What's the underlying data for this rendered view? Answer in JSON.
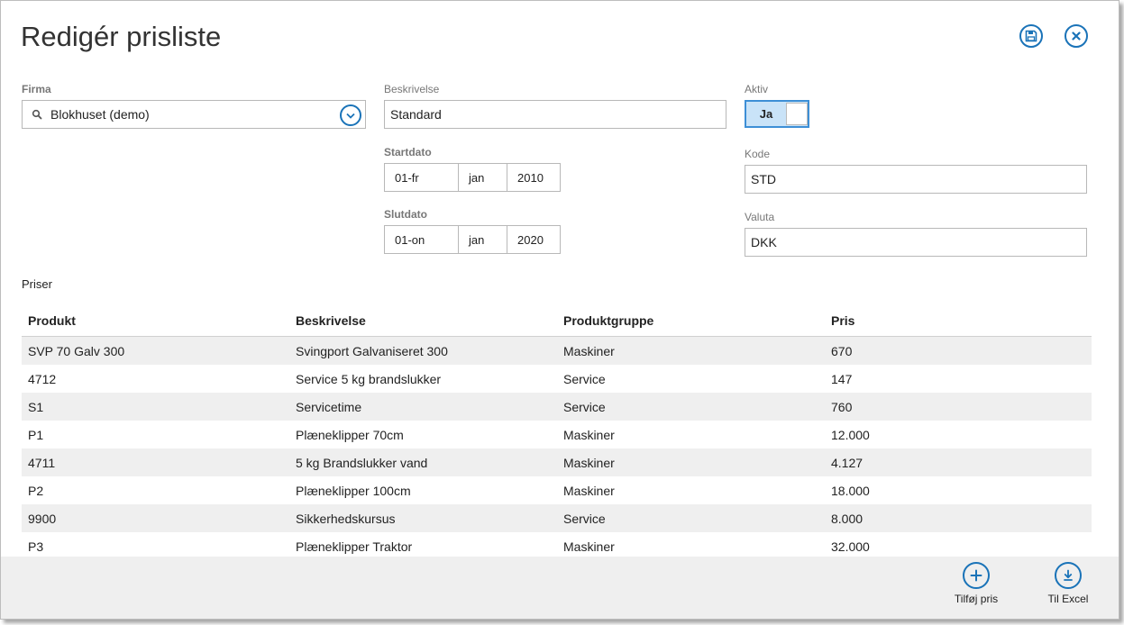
{
  "title": "Redigér prisliste",
  "header_icons": {
    "save": "save-icon",
    "close": "close-icon"
  },
  "firma": {
    "label": "Firma",
    "value": "Blokhuset (demo)"
  },
  "beskrivelse": {
    "label": "Beskrivelse",
    "value": "Standard"
  },
  "startdato": {
    "label": "Startdato",
    "day": "01-fr",
    "month": "jan",
    "year": "2010"
  },
  "slutdato": {
    "label": "Slutdato",
    "day": "01-on",
    "month": "jan",
    "year": "2020"
  },
  "aktiv": {
    "label": "Aktiv",
    "value": "Ja",
    "on": true
  },
  "kode": {
    "label": "Kode",
    "value": "STD"
  },
  "valuta": {
    "label": "Valuta",
    "value": "DKK"
  },
  "priser": {
    "label": "Priser",
    "columns": [
      "Produkt",
      "Beskrivelse",
      "Produktgruppe",
      "Pris"
    ],
    "rows": [
      [
        "SVP 70 Galv 300",
        "Svingport Galvaniseret 300",
        "Maskiner",
        "670"
      ],
      [
        "4712",
        "Service 5 kg brandslukker",
        "Service",
        "147"
      ],
      [
        "S1",
        "Servicetime",
        "Service",
        "760"
      ],
      [
        "P1",
        "Plæneklipper 70cm",
        "Maskiner",
        "12.000"
      ],
      [
        "4711",
        "5 kg Brandslukker vand",
        "Maskiner",
        "4.127"
      ],
      [
        "P2",
        "Plæneklipper 100cm",
        "Maskiner",
        "18.000"
      ],
      [
        "9900",
        "Sikkerhedskursus",
        "Service",
        "8.000"
      ],
      [
        "P3",
        "Plæneklipper Traktor",
        "Maskiner",
        "32.000"
      ]
    ]
  },
  "footer": {
    "add_label": "Tilføj pris",
    "excel_label": "Til Excel"
  },
  "colors": {
    "accent": "#1a73b8",
    "toggle_bg": "#c9e3f8",
    "stripe": "#efefef",
    "footer_bg": "#efefef"
  }
}
